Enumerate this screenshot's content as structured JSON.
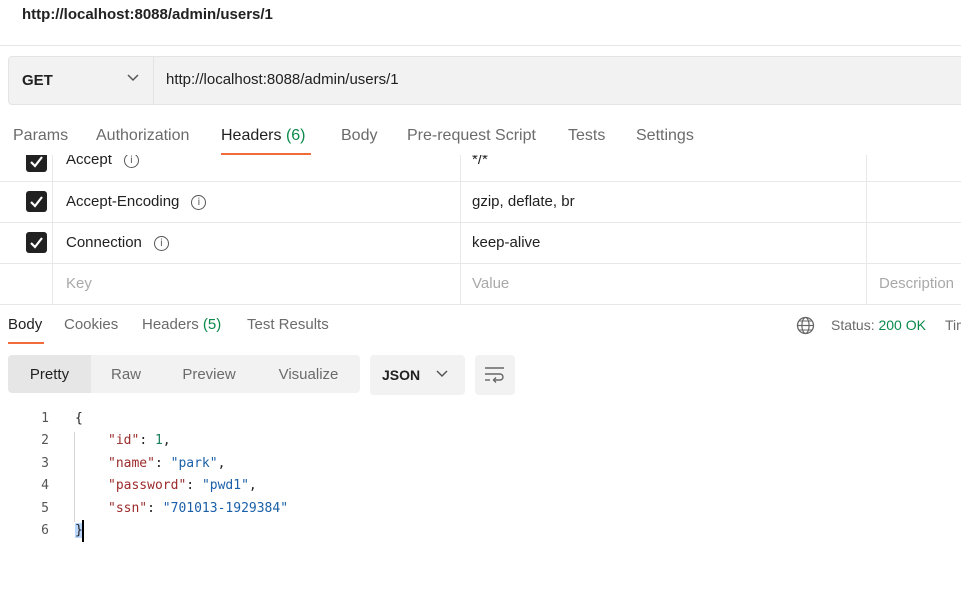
{
  "request": {
    "title": "http://localhost:8088/admin/users/1",
    "method": "GET",
    "url": "http://localhost:8088/admin/users/1"
  },
  "request_tabs": [
    {
      "label": "Params"
    },
    {
      "label": "Authorization"
    },
    {
      "label": "Headers",
      "count": "(6)"
    },
    {
      "label": "Body"
    },
    {
      "label": "Pre-request Script"
    },
    {
      "label": "Tests"
    },
    {
      "label": "Settings"
    }
  ],
  "headers": [
    {
      "key": "Accept",
      "value": "*/*",
      "checked": true
    },
    {
      "key": "Accept-Encoding",
      "value": "gzip, deflate, br",
      "checked": true
    },
    {
      "key": "Connection",
      "value": "keep-alive",
      "checked": true
    }
  ],
  "headers_placeholder": {
    "key": "Key",
    "value": "Value",
    "description": "Description"
  },
  "response_tabs": [
    {
      "label": "Body"
    },
    {
      "label": "Cookies"
    },
    {
      "label": "Headers",
      "count": "(5)"
    },
    {
      "label": "Test Results"
    }
  ],
  "status": {
    "label": "Status:",
    "value": "200 OK",
    "next_clipped": "Tim"
  },
  "format_buttons": [
    "Pretty",
    "Raw",
    "Preview",
    "Visualize"
  ],
  "language": "JSON",
  "code_lines": [
    {
      "n": "1",
      "text": "{"
    },
    {
      "n": "2",
      "key": "\"id\"",
      "sep": ": ",
      "val": "1",
      "type": "num",
      "tail": ","
    },
    {
      "n": "3",
      "key": "\"name\"",
      "sep": ": ",
      "val": "\"park\"",
      "type": "str",
      "tail": ","
    },
    {
      "n": "4",
      "key": "\"password\"",
      "sep": ": ",
      "val": "\"pwd1\"",
      "type": "str",
      "tail": ","
    },
    {
      "n": "5",
      "key": "\"ssn\"",
      "sep": ": ",
      "val": "\"701013-1929384\"",
      "type": "str",
      "tail": ""
    },
    {
      "n": "6",
      "text": "}"
    }
  ],
  "colors": {
    "accent": "#f26b3a",
    "success": "#0b8a4b",
    "json_key": "#9c2b2b",
    "json_string": "#1a5fa8"
  }
}
